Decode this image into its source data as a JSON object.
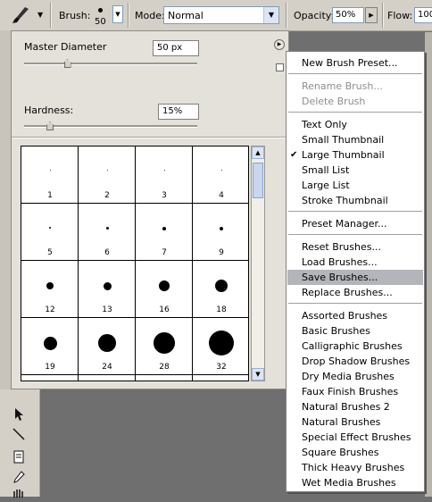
{
  "options_bar": {
    "brush_label": "Brush:",
    "brush_size": "50",
    "mode_label": "Mode:",
    "mode_value": "Normal",
    "opacity_label": "Opacity:",
    "opacity_value": "50%",
    "flow_label": "Flow:",
    "flow_value": "100"
  },
  "brush_panel": {
    "master_diameter_label": "Master Diameter",
    "master_diameter_value": "50 px",
    "master_diameter_level": 0.25,
    "hardness_label": "Hardness:",
    "hardness_value": "15%",
    "hardness_level": 0.15,
    "presets": [
      {
        "label": "1",
        "size": 1
      },
      {
        "label": "2",
        "size": 1
      },
      {
        "label": "3",
        "size": 1
      },
      {
        "label": "4",
        "size": 1
      },
      {
        "label": "5",
        "size": 2
      },
      {
        "label": "6",
        "size": 3
      },
      {
        "label": "7",
        "size": 4
      },
      {
        "label": "9",
        "size": 4
      },
      {
        "label": "12",
        "size": 8
      },
      {
        "label": "13",
        "size": 9
      },
      {
        "label": "16",
        "size": 12
      },
      {
        "label": "18",
        "size": 14
      },
      {
        "label": "19",
        "size": 15
      },
      {
        "label": "24",
        "size": 20
      },
      {
        "label": "28",
        "size": 24
      },
      {
        "label": "32",
        "size": 28
      }
    ]
  },
  "menu": {
    "groups": [
      [
        {
          "label": "New Brush Preset...",
          "enabled": true
        }
      ],
      [
        {
          "label": "Rename Brush...",
          "enabled": false
        },
        {
          "label": "Delete Brush",
          "enabled": false
        }
      ],
      [
        {
          "label": "Text Only",
          "enabled": true
        },
        {
          "label": "Small Thumbnail",
          "enabled": true
        },
        {
          "label": "Large Thumbnail",
          "enabled": true,
          "checked": true
        },
        {
          "label": "Small List",
          "enabled": true
        },
        {
          "label": "Large List",
          "enabled": true
        },
        {
          "label": "Stroke Thumbnail",
          "enabled": true
        }
      ],
      [
        {
          "label": "Preset Manager...",
          "enabled": true
        }
      ],
      [
        {
          "label": "Reset Brushes...",
          "enabled": true
        },
        {
          "label": "Load Brushes...",
          "enabled": true
        },
        {
          "label": "Save Brushes...",
          "enabled": true,
          "highlighted": true
        },
        {
          "label": "Replace Brushes...",
          "enabled": true
        }
      ],
      [
        {
          "label": "Assorted Brushes",
          "enabled": true
        },
        {
          "label": "Basic Brushes",
          "enabled": true
        },
        {
          "label": "Calligraphic Brushes",
          "enabled": true
        },
        {
          "label": "Drop Shadow Brushes",
          "enabled": true
        },
        {
          "label": "Dry Media Brushes",
          "enabled": true
        },
        {
          "label": "Faux Finish Brushes",
          "enabled": true
        },
        {
          "label": "Natural Brushes 2",
          "enabled": true
        },
        {
          "label": "Natural Brushes",
          "enabled": true
        },
        {
          "label": "Special Effect Brushes",
          "enabled": true
        },
        {
          "label": "Square Brushes",
          "enabled": true
        },
        {
          "label": "Thick Heavy Brushes",
          "enabled": true
        },
        {
          "label": "Wet Media Brushes",
          "enabled": true
        }
      ]
    ]
  },
  "icons": {
    "brush_tool": "brush-icon",
    "panel_menu": "panel-menu-icon",
    "scroll_up": "chevron-up-icon",
    "scroll_down": "chevron-down-icon",
    "check": "check-icon"
  }
}
